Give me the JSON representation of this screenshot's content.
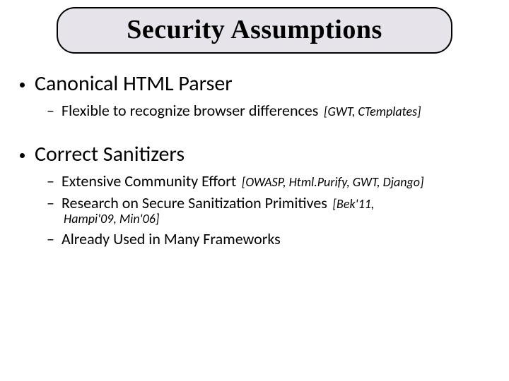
{
  "title": "Security Assumptions",
  "bullets": [
    {
      "text": "Canonical HTML Parser",
      "sub": [
        {
          "text": "Flexible to recognize browser differences",
          "cite": "[GWT, CTemplates]"
        }
      ]
    },
    {
      "text": "Correct Sanitizers",
      "sub": [
        {
          "text": "Extensive Community Effort",
          "cite": "[OWASP, Html.Purify, GWT, Django]"
        },
        {
          "text": "Research on Secure Sanitization Primitives",
          "cite": "[Bek'11,",
          "cite_cont": "Hampi'09, Min'06]"
        },
        {
          "text": "Already Used in Many Frameworks"
        }
      ]
    }
  ]
}
